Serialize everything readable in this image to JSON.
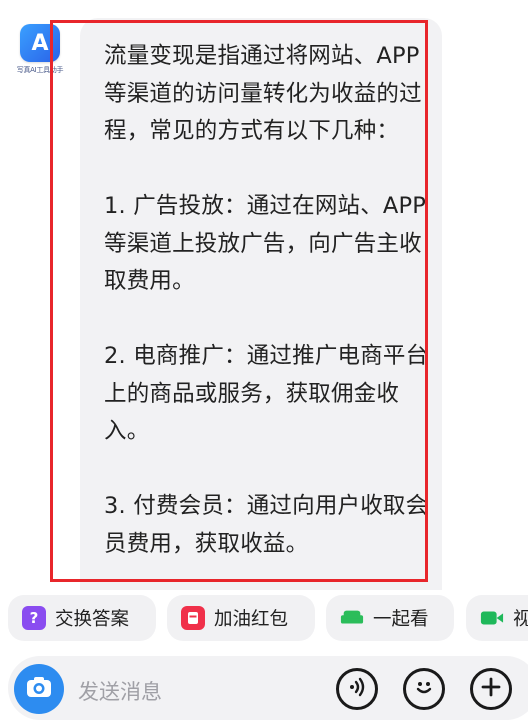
{
  "chat": {
    "bot_avatar": {
      "logo_letter": "A",
      "logo_caption": "写真AI工具助手",
      "accent": "#2a62e8"
    },
    "message_text": "流量变现是指通过将网站、APP等渠道的访问量转化为收益的过程，常见的方式有以下几种：\n\n1. 广告投放：通过在网站、APP等渠道上投放广告，向广告主收取费用。\n\n2. 电商推广：通过推广电商平台上的商品或服务，获取佣金收入。\n\n3. 付费会员：通过向用户收取会员费用，获取收益。",
    "highlight_color": "#e8262b"
  },
  "quick_actions": [
    {
      "label": "交换答案",
      "icon": "question-icon",
      "icon_glyph": "?",
      "color": "#8a4cf0"
    },
    {
      "label": "加油红包",
      "icon": "red-packet-icon",
      "icon_glyph": "",
      "color": "#f0304a"
    },
    {
      "label": "一起看",
      "icon": "sofa-icon",
      "icon_glyph": "",
      "color": "#2bbd5a"
    },
    {
      "label": "视",
      "icon": "video-icon",
      "icon_glyph": "",
      "color": "#1fb85a"
    }
  ],
  "input_bar": {
    "placeholder": "发送消息",
    "camera_icon": "camera-icon",
    "voice_icon": "voice-icon",
    "emoji_icon": "emoji-icon",
    "plus_icon": "plus-icon",
    "accent": "#2d8cf0"
  }
}
